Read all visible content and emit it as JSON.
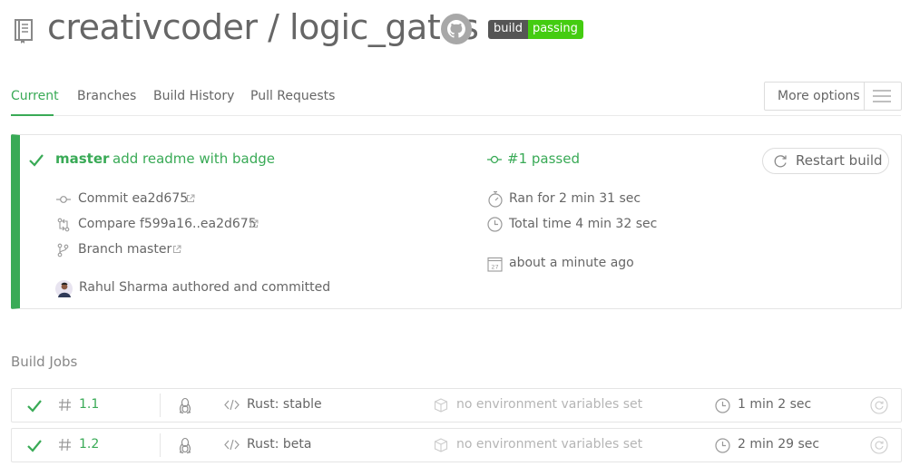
{
  "header": {
    "owner": "creativcoder",
    "separator": " / ",
    "repo": "logic_gates",
    "badge_left": "build",
    "badge_right": "passing",
    "icons": [
      "repo-icon",
      "github-icon"
    ]
  },
  "tabs": [
    {
      "label": "Current",
      "active": true
    },
    {
      "label": "Branches",
      "active": false
    },
    {
      "label": "Build History",
      "active": false
    },
    {
      "label": "Pull Requests",
      "active": false
    }
  ],
  "more_options": {
    "label": "More options",
    "icon": "hamburger-icon"
  },
  "build": {
    "status": "passed",
    "branch": "master",
    "commit_message": "add readme with badge",
    "build_number": "#1 passed",
    "restart_label": "Restart build",
    "commit": "Commit ea2d675",
    "compare": "Compare f599a16..ea2d675",
    "branch_link": "Branch master",
    "author": "Rahul Sharma authored and committed",
    "ran_for": "Ran for 2 min 31 sec",
    "total_time": "Total time 4 min 32 sec",
    "finished": "about a minute ago",
    "calendar_day": "27",
    "colors": {
      "passed": "#39aa56",
      "badge_dark": "#555555",
      "badge_green": "#44cc11"
    }
  },
  "jobs": {
    "title": "Build Jobs",
    "items": [
      {
        "number": "1.1",
        "language": "Rust: stable",
        "env": "no environment variables set",
        "duration": "1 min 2 sec",
        "os": "linux-icon"
      },
      {
        "number": "1.2",
        "language": "Rust: beta",
        "env": "no environment variables set",
        "duration": "2 min 29 sec",
        "os": "linux-icon"
      }
    ]
  }
}
